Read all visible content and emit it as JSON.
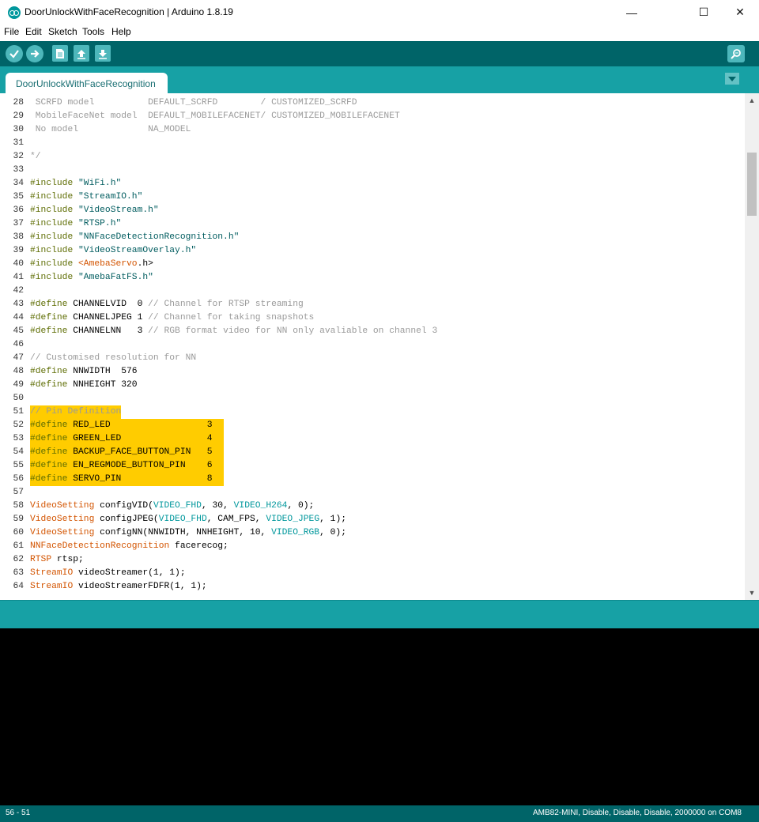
{
  "window": {
    "title": "DoorUnlockWithFaceRecognition | Arduino 1.8.19",
    "minimize": "—",
    "maximize": "☐",
    "close": "✕"
  },
  "menu": [
    "File",
    "Edit",
    "Sketch",
    "Tools",
    "Help"
  ],
  "toolbar": {
    "buttons": [
      "verify-icon",
      "upload-icon",
      "new-icon",
      "open-icon",
      "save-icon"
    ],
    "serial_monitor": "serial-monitor-icon"
  },
  "tabs": [
    {
      "label": "DoorUnlockWithFaceRecognition"
    }
  ],
  "editor": {
    "lines": [
      {
        "n": "28",
        "parts": [
          {
            "t": " SCRFD model          DEFAULT_SCRFD        / CUSTOMIZED_SCRFD",
            "c": "cm"
          }
        ]
      },
      {
        "n": "29",
        "parts": [
          {
            "t": " MobileFaceNet model  DEFAULT_MOBILEFACENET/ CUSTOMIZED_MOBILEFACENET",
            "c": "cm"
          }
        ]
      },
      {
        "n": "30",
        "parts": [
          {
            "t": " No model             NA_MODEL",
            "c": "cm"
          }
        ]
      },
      {
        "n": "31",
        "parts": []
      },
      {
        "n": "32",
        "parts": [
          {
            "t": "*/",
            "c": "cm"
          }
        ]
      },
      {
        "n": "33",
        "parts": []
      },
      {
        "n": "34",
        "parts": [
          {
            "t": "#include ",
            "c": "kw"
          },
          {
            "t": "\"WiFi.h\"",
            "c": "str"
          }
        ]
      },
      {
        "n": "35",
        "parts": [
          {
            "t": "#include ",
            "c": "kw"
          },
          {
            "t": "\"StreamIO.h\"",
            "c": "str"
          }
        ]
      },
      {
        "n": "36",
        "parts": [
          {
            "t": "#include ",
            "c": "kw"
          },
          {
            "t": "\"VideoStream.h\"",
            "c": "str"
          }
        ]
      },
      {
        "n": "37",
        "parts": [
          {
            "t": "#include ",
            "c": "kw"
          },
          {
            "t": "\"RTSP.h\"",
            "c": "str"
          }
        ]
      },
      {
        "n": "38",
        "parts": [
          {
            "t": "#include ",
            "c": "kw"
          },
          {
            "t": "\"NNFaceDetectionRecognition.h\"",
            "c": "str"
          }
        ]
      },
      {
        "n": "39",
        "parts": [
          {
            "t": "#include ",
            "c": "kw"
          },
          {
            "t": "\"VideoStreamOverlay.h\"",
            "c": "str"
          }
        ]
      },
      {
        "n": "40",
        "parts": [
          {
            "t": "#include ",
            "c": "kw"
          },
          {
            "t": "<",
            "c": "ty"
          },
          {
            "t": "AmebaServo",
            "c": "ty"
          },
          {
            "t": ".h>",
            "c": ""
          }
        ]
      },
      {
        "n": "41",
        "parts": [
          {
            "t": "#include ",
            "c": "kw"
          },
          {
            "t": "\"AmebaFatFS.h\"",
            "c": "str"
          }
        ]
      },
      {
        "n": "42",
        "parts": []
      },
      {
        "n": "43",
        "parts": [
          {
            "t": "#define ",
            "c": "kw"
          },
          {
            "t": "CHANNELVID  0 ",
            "c": ""
          },
          {
            "t": "// Channel for RTSP streaming",
            "c": "cm"
          }
        ]
      },
      {
        "n": "44",
        "parts": [
          {
            "t": "#define ",
            "c": "kw"
          },
          {
            "t": "CHANNELJPEG 1 ",
            "c": ""
          },
          {
            "t": "// Channel for taking snapshots",
            "c": "cm"
          }
        ]
      },
      {
        "n": "45",
        "parts": [
          {
            "t": "#define ",
            "c": "kw"
          },
          {
            "t": "CHANNELNN   3 ",
            "c": ""
          },
          {
            "t": "// RGB format video for NN only avaliable on channel 3",
            "c": "cm"
          }
        ]
      },
      {
        "n": "46",
        "parts": []
      },
      {
        "n": "47",
        "parts": [
          {
            "t": "// Customised resolution for NN",
            "c": "cm"
          }
        ]
      },
      {
        "n": "48",
        "parts": [
          {
            "t": "#define ",
            "c": "kw"
          },
          {
            "t": "NNWIDTH  576",
            "c": ""
          }
        ]
      },
      {
        "n": "49",
        "parts": [
          {
            "t": "#define ",
            "c": "kw"
          },
          {
            "t": "NNHEIGHT 320",
            "c": ""
          }
        ]
      },
      {
        "n": "50",
        "parts": []
      },
      {
        "n": "51",
        "hl": "short",
        "parts": [
          {
            "t": "// Pin Definition",
            "c": "cm"
          }
        ]
      },
      {
        "n": "52",
        "hl": "long",
        "parts": [
          {
            "t": "#define ",
            "c": "kw"
          },
          {
            "t": "RED_LED                  3",
            "c": ""
          }
        ]
      },
      {
        "n": "53",
        "hl": "long",
        "parts": [
          {
            "t": "#define ",
            "c": "kw"
          },
          {
            "t": "GREEN_LED                4",
            "c": ""
          }
        ]
      },
      {
        "n": "54",
        "hl": "long",
        "parts": [
          {
            "t": "#define ",
            "c": "kw"
          },
          {
            "t": "BACKUP_FACE_BUTTON_PIN   5",
            "c": ""
          }
        ]
      },
      {
        "n": "55",
        "hl": "long",
        "parts": [
          {
            "t": "#define ",
            "c": "kw"
          },
          {
            "t": "EN_REGMODE_BUTTON_PIN    6",
            "c": ""
          }
        ]
      },
      {
        "n": "56",
        "hl": "long",
        "parts": [
          {
            "t": "#define ",
            "c": "kw"
          },
          {
            "t": "SERVO_PIN                8",
            "c": ""
          }
        ]
      },
      {
        "n": "57",
        "parts": []
      },
      {
        "n": "58",
        "parts": [
          {
            "t": "VideoSetting",
            "c": "ty"
          },
          {
            "t": " configVID(",
            "c": ""
          },
          {
            "t": "VIDEO_FHD",
            "c": "cn"
          },
          {
            "t": ", 30, ",
            "c": ""
          },
          {
            "t": "VIDEO_H264",
            "c": "cn"
          },
          {
            "t": ", 0);",
            "c": ""
          }
        ]
      },
      {
        "n": "59",
        "parts": [
          {
            "t": "VideoSetting",
            "c": "ty"
          },
          {
            "t": " configJPEG(",
            "c": ""
          },
          {
            "t": "VIDEO_FHD",
            "c": "cn"
          },
          {
            "t": ", CAM_FPS, ",
            "c": ""
          },
          {
            "t": "VIDEO_JPEG",
            "c": "cn"
          },
          {
            "t": ", 1);",
            "c": ""
          }
        ]
      },
      {
        "n": "60",
        "parts": [
          {
            "t": "VideoSetting",
            "c": "ty"
          },
          {
            "t": " configNN(NNWIDTH, NNHEIGHT, 10, ",
            "c": ""
          },
          {
            "t": "VIDEO_RGB",
            "c": "cn"
          },
          {
            "t": ", 0);",
            "c": ""
          }
        ]
      },
      {
        "n": "61",
        "parts": [
          {
            "t": "NNFaceDetectionRecognition",
            "c": "ty"
          },
          {
            "t": " facerecog;",
            "c": ""
          }
        ]
      },
      {
        "n": "62",
        "parts": [
          {
            "t": "RTSP",
            "c": "ty"
          },
          {
            "t": " rtsp;",
            "c": ""
          }
        ]
      },
      {
        "n": "63",
        "parts": [
          {
            "t": "StreamIO",
            "c": "ty"
          },
          {
            "t": " videoStreamer(1, 1);",
            "c": ""
          }
        ]
      },
      {
        "n": "64",
        "parts": [
          {
            "t": "StreamIO",
            "c": "ty"
          },
          {
            "t": " videoStreamerFDFR(1, 1);",
            "c": ""
          }
        ]
      }
    ]
  },
  "status": {
    "left": "56 - 51",
    "right": "AMB82-MINI, Disable, Disable, Disable, 2000000 on COM8"
  },
  "colors": {
    "toolbar": "#006468",
    "tabbar": "#17a1a5",
    "highlight": "#ffcc00"
  }
}
